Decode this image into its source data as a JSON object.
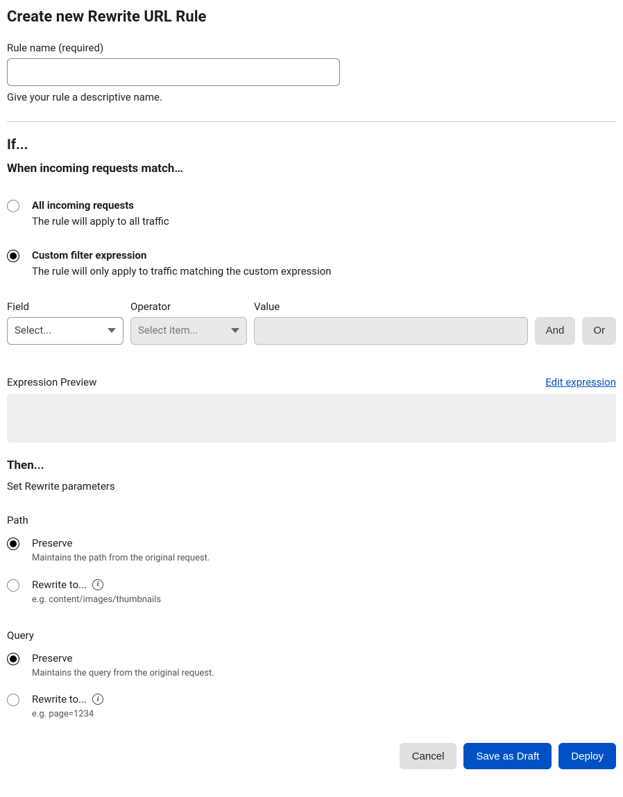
{
  "page": {
    "title": "Create new Rewrite URL Rule"
  },
  "rule_name": {
    "label": "Rule name (required)",
    "value": "",
    "help": "Give your rule a descriptive name."
  },
  "if_section": {
    "heading": "If...",
    "subheading": "When incoming requests match…",
    "option_all": {
      "title": "All incoming requests",
      "desc": "The rule will apply to all traffic"
    },
    "option_custom": {
      "title": "Custom filter expression",
      "desc": "The rule will only apply to traffic matching the custom expression"
    }
  },
  "expression": {
    "field_label": "Field",
    "field_value": "Select...",
    "operator_label": "Operator",
    "operator_value": "Select item...",
    "value_label": "Value",
    "and_label": "And",
    "or_label": "Or"
  },
  "preview": {
    "label": "Expression Preview",
    "edit_link": "Edit expression"
  },
  "then_section": {
    "heading": "Then...",
    "sub": "Set Rewrite parameters"
  },
  "path": {
    "label": "Path",
    "preserve_title": "Preserve",
    "preserve_desc": "Maintains the path from the original request.",
    "rewrite_title": "Rewrite to...",
    "rewrite_desc": "e.g. content/images/thumbnails"
  },
  "query": {
    "label": "Query",
    "preserve_title": "Preserve",
    "preserve_desc": "Maintains the query from the original request.",
    "rewrite_title": "Rewrite to...",
    "rewrite_desc": "e.g. page=1234"
  },
  "buttons": {
    "cancel": "Cancel",
    "draft": "Save as Draft",
    "deploy": "Deploy"
  }
}
